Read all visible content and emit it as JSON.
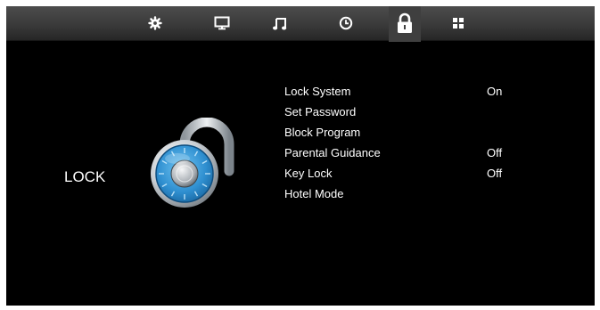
{
  "header": {
    "tabs": [
      {
        "id": "setup",
        "icon": "gear-icon"
      },
      {
        "id": "picture",
        "icon": "monitor-icon"
      },
      {
        "id": "sound",
        "icon": "music-note-icon"
      },
      {
        "id": "time",
        "icon": "clock-icon"
      },
      {
        "id": "lock",
        "icon": "padlock-icon",
        "selected": true
      },
      {
        "id": "app",
        "icon": "grid-icon"
      }
    ]
  },
  "main": {
    "section_title": "LOCK",
    "icon": "padlock-icon",
    "menu": [
      {
        "label": "Lock System",
        "value": "On"
      },
      {
        "label": "Set Password",
        "value": ""
      },
      {
        "label": "Block Program",
        "value": ""
      },
      {
        "label": "Parental Guidance",
        "value": "Off"
      },
      {
        "label": "Key Lock",
        "value": "Off"
      },
      {
        "label": "Hotel Mode",
        "value": ""
      }
    ]
  },
  "colors": {
    "background": "#000000",
    "text": "#ffffff",
    "bar": "#3a3a3a",
    "lock_blue": "#2f8fd0"
  }
}
